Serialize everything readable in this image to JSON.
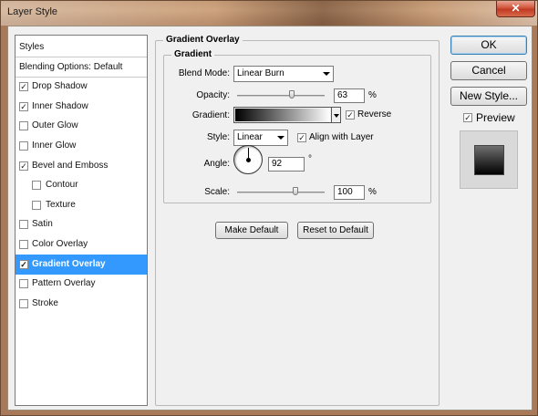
{
  "window": {
    "title": "Layer Style",
    "close_glyph": "✕"
  },
  "left_panel": {
    "items": [
      {
        "label": "Styles",
        "checkbox": false,
        "checked": false,
        "indent": false,
        "selected": false
      },
      {
        "label": "Blending Options: Default",
        "checkbox": false,
        "checked": false,
        "indent": false,
        "selected": false
      },
      {
        "label": "Drop Shadow",
        "checkbox": true,
        "checked": true,
        "indent": false,
        "selected": false
      },
      {
        "label": "Inner Shadow",
        "checkbox": true,
        "checked": true,
        "indent": false,
        "selected": false
      },
      {
        "label": "Outer Glow",
        "checkbox": true,
        "checked": false,
        "indent": false,
        "selected": false
      },
      {
        "label": "Inner Glow",
        "checkbox": true,
        "checked": false,
        "indent": false,
        "selected": false
      },
      {
        "label": "Bevel and Emboss",
        "checkbox": true,
        "checked": true,
        "indent": false,
        "selected": false
      },
      {
        "label": "Contour",
        "checkbox": true,
        "checked": false,
        "indent": true,
        "selected": false
      },
      {
        "label": "Texture",
        "checkbox": true,
        "checked": false,
        "indent": true,
        "selected": false
      },
      {
        "label": "Satin",
        "checkbox": true,
        "checked": false,
        "indent": false,
        "selected": false
      },
      {
        "label": "Color Overlay",
        "checkbox": true,
        "checked": false,
        "indent": false,
        "selected": false
      },
      {
        "label": "Gradient Overlay",
        "checkbox": true,
        "checked": true,
        "indent": false,
        "selected": true
      },
      {
        "label": "Pattern Overlay",
        "checkbox": true,
        "checked": false,
        "indent": false,
        "selected": false
      },
      {
        "label": "Stroke",
        "checkbox": true,
        "checked": false,
        "indent": false,
        "selected": false
      }
    ]
  },
  "gradient_overlay": {
    "group_title": "Gradient Overlay",
    "subgroup_title": "Gradient",
    "blend_mode": {
      "label": "Blend Mode:",
      "value": "Linear Burn"
    },
    "opacity": {
      "label": "Opacity:",
      "value": "63",
      "unit": "%",
      "level": 0.63
    },
    "gradient": {
      "label": "Gradient:",
      "colors": [
        "#000000",
        "#ffffff"
      ]
    },
    "reverse": {
      "label": "Reverse",
      "checked": true
    },
    "style": {
      "label": "Style:",
      "value": "Linear"
    },
    "align_with_layer": {
      "label": "Align with Layer",
      "checked": true
    },
    "angle": {
      "label": "Angle:",
      "value": "92",
      "unit": "°"
    },
    "scale": {
      "label": "Scale:",
      "value": "100",
      "unit": "%",
      "level": 0.67
    },
    "make_default_label": "Make Default",
    "reset_default_label": "Reset to Default"
  },
  "buttons": {
    "ok": "OK",
    "cancel": "Cancel",
    "new_style": "New Style..."
  },
  "preview": {
    "label": "Preview",
    "checked": true
  },
  "check_glyph": "✓",
  "colors": {
    "selection": "#3399ff",
    "dialog_bg": "#f0f0f0"
  }
}
